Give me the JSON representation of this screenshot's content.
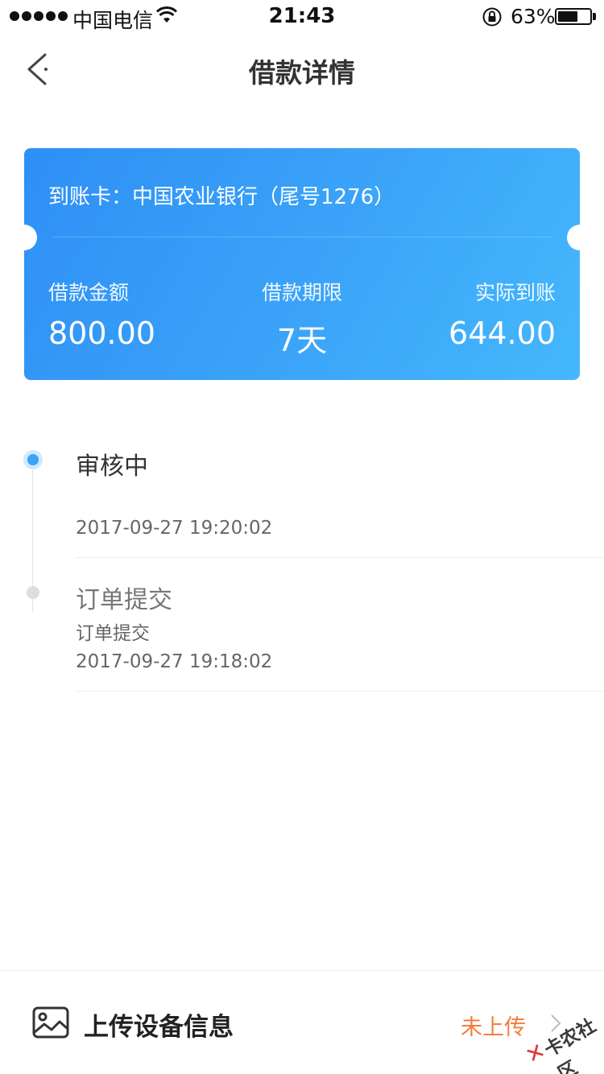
{
  "status_bar": {
    "carrier": "中国电信",
    "time": "21:43",
    "battery_pct": "63%",
    "battery_level": 0.63
  },
  "nav": {
    "title": "借款详情",
    "back_icon": "chevron-left-icon"
  },
  "card": {
    "bank": "到账卡：中国农业银行（尾号1276）",
    "colors": {
      "start": "#2e8ff5",
      "end": "#45b8fc"
    },
    "stats": [
      {
        "label": "借款金额",
        "value": "800.00"
      },
      {
        "label": "借款期限",
        "value": "7天"
      },
      {
        "label": "实际到账",
        "value": "644.00"
      }
    ]
  },
  "timeline": [
    {
      "title": "审核中",
      "subtitle": "",
      "time": "2017-09-27 19:20:02",
      "active": true
    },
    {
      "title": "订单提交",
      "subtitle": "订单提交",
      "time": "2017-09-27 19:18:02",
      "active": false
    }
  ],
  "upload": {
    "icon": "image-icon",
    "label": "上传设备信息",
    "status": "未上传",
    "status_color": "#f47c3c"
  },
  "watermark": {
    "text": "卡农社区"
  }
}
